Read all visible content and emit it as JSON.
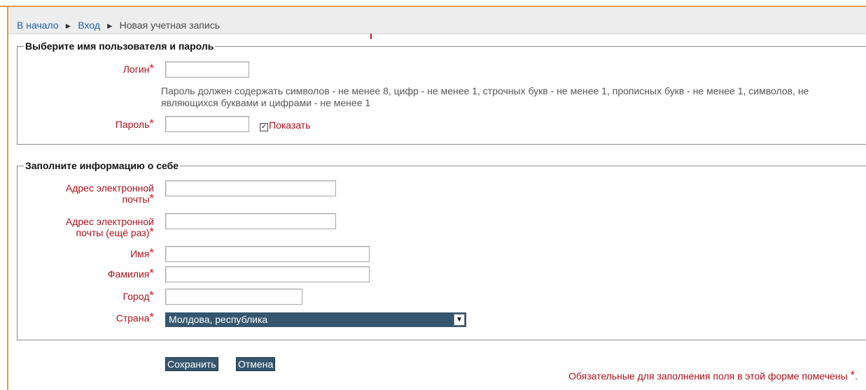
{
  "breadcrumb": {
    "home": "В начало",
    "login": "Вход",
    "current": "Новая учетная запись",
    "separator": "►"
  },
  "section_account": {
    "legend": "Выберите имя пользователя и пароль",
    "login_label": "Логин",
    "password_hint": "Пароль должен содержать символов - не менее 8, цифр - не менее 1, строчных букв - не менее 1, прописных букв - не менее 1, символов, не являющихся буквами и цифрами - не менее 1",
    "password_label": "Пароль",
    "show_password_label": "Показать",
    "show_password_checked": true
  },
  "section_profile": {
    "legend": "Заполните информацию о себе",
    "email_label_line1": "Адрес электронной",
    "email_label_line2": "почты",
    "email2_label_line1": "Адрес электронной",
    "email2_label_line2": "почты (ещё раз)",
    "firstname_label": "Имя",
    "lastname_label": "Фамилия",
    "city_label": "Город",
    "country_label": "Страна",
    "country_value": "Молдова, республика"
  },
  "required_marker": "*",
  "buttons": {
    "save": "Сохранить",
    "cancel": "Отмена"
  },
  "required_note": "Обязательные для заполнения поля в этой форме помечены",
  "colors": {
    "accent_frame": "#e09a46",
    "label_red": "#b0121b",
    "button_bg": "#35566e",
    "link_blue": "#1f5f9e"
  }
}
